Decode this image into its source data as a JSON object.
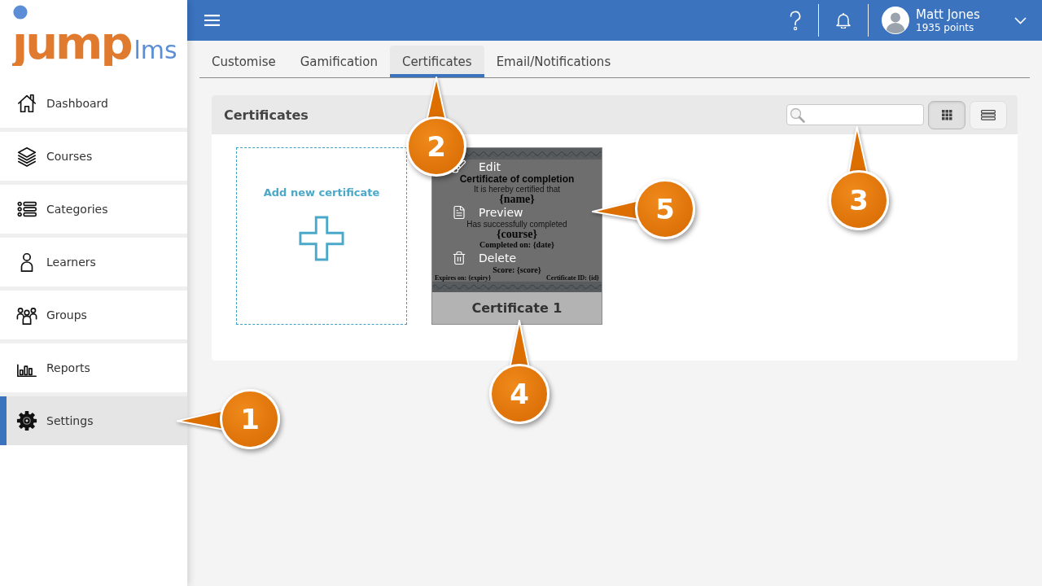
{
  "logo": {
    "brand": "jump",
    "suffix": "lms"
  },
  "sidebar": {
    "items": [
      {
        "label": "Dashboard",
        "kind": "home",
        "selected": false
      },
      {
        "label": "Courses",
        "kind": "stack",
        "selected": false
      },
      {
        "label": "Categories",
        "kind": "list",
        "selected": false
      },
      {
        "label": "Learners",
        "kind": "person",
        "selected": false
      },
      {
        "label": "Groups",
        "kind": "group",
        "selected": false
      },
      {
        "label": "Reports",
        "kind": "chart",
        "selected": false
      },
      {
        "label": "Settings",
        "kind": "gear",
        "selected": true
      }
    ]
  },
  "topbar": {
    "user": {
      "name": "Matt Jones",
      "points": "1935 points"
    }
  },
  "tabs": [
    {
      "label": "Customise",
      "selected": false
    },
    {
      "label": "Gamification",
      "selected": false
    },
    {
      "label": "Certificates",
      "selected": true
    },
    {
      "label": "Email/Notifications",
      "selected": false
    }
  ],
  "panel": {
    "title": "Certificates",
    "view_buttons": [
      {
        "kind": "grid",
        "selected": true
      },
      {
        "kind": "list",
        "selected": false
      }
    ],
    "add_card": {
      "label": "Add new certificate"
    },
    "certificates": [
      {
        "name": "Certificate 1",
        "hovered": true,
        "thumbnail": {
          "lines": [
            {
              "kind": "title",
              "text": "Certificate of completion"
            },
            {
              "kind": "text",
              "text": "It is hereby certified that"
            },
            {
              "kind": "field",
              "text": "{name}"
            },
            {
              "kind": "text",
              "text": "Has successfully completed"
            },
            {
              "kind": "field",
              "text": "{course}"
            },
            {
              "kind": "detail",
              "text": "Completed on: {date}"
            },
            {
              "kind": "detail",
              "text": "Score: {score}"
            }
          ],
          "footer_left": "Expires on: {expiry}",
          "footer_right": "Certificate ID: {id}"
        },
        "menu": [
          {
            "kind": "edit",
            "label": "Edit"
          },
          {
            "kind": "preview",
            "label": "Preview"
          },
          {
            "kind": "delete",
            "label": "Delete"
          }
        ]
      }
    ]
  },
  "callouts": [
    {
      "label": "1"
    },
    {
      "label": "2"
    },
    {
      "label": "3"
    },
    {
      "label": "4"
    },
    {
      "label": "5"
    }
  ]
}
